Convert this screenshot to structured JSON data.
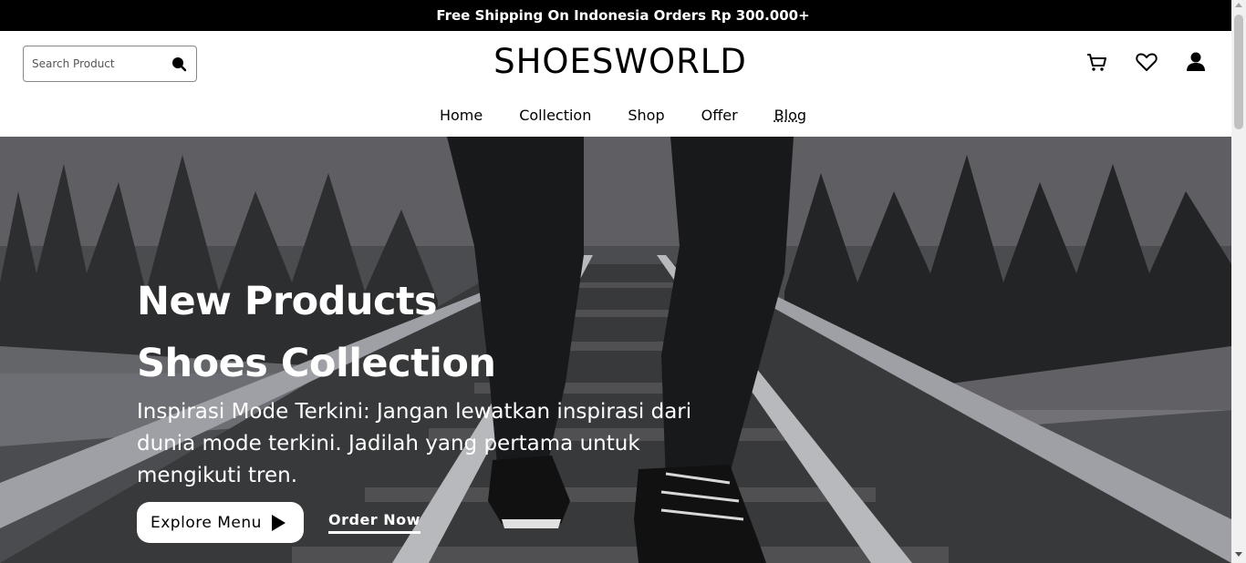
{
  "announcement": "Free Shipping On Indonesia Orders Rp 300.000+",
  "search": {
    "placeholder": "Search Product"
  },
  "brand": "SHOESWORLD",
  "header_icons": [
    "cart-icon",
    "heart-icon",
    "user-icon"
  ],
  "nav": [
    "Home",
    "Collection",
    "Shop",
    "Offer",
    "Blog"
  ],
  "hero": {
    "title_line1": "New Products",
    "title_line2": "Shoes Collection",
    "description": "Inspirasi Mode Terkini: Jangan lewatkan inspirasi dari dunia mode terkini. Jadilah yang pertama untuk mengikuti tren.",
    "explore_label": "Explore Menu",
    "order_label": "Order Now"
  },
  "colors": {
    "topbar": "#000000",
    "text": "#000000",
    "hero_text": "#ffffff"
  }
}
